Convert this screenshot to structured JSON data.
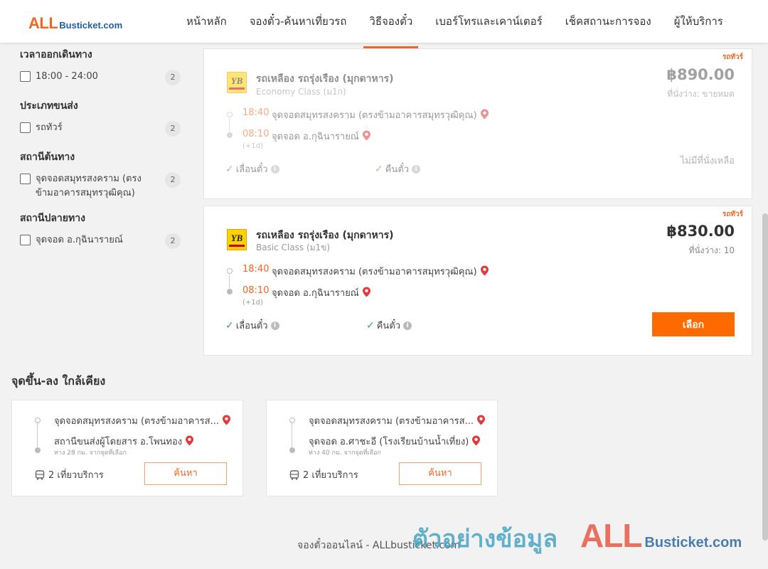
{
  "header": {
    "logo_all": "ALL",
    "logo_bus": "Busticket.com",
    "nav": [
      "หน้าหลัก",
      "จองตั๋ว-ค้นหาเที่ยวรถ",
      "วิธีจองตั๋ว",
      "เบอร์โทรและเคาน์เตอร์",
      "เช็คสถานะการจอง",
      "ผู้ให้บริการ"
    ]
  },
  "filters": {
    "depart_time": {
      "title": "เวลาออกเดินทาง",
      "items": [
        {
          "label": "18:00 - 24:00",
          "count": "2"
        }
      ]
    },
    "vehicle_type": {
      "title": "ประเภทขนส่ง",
      "items": [
        {
          "label": "รถทัวร์",
          "count": "2"
        }
      ]
    },
    "origin": {
      "title": "สถานีต้นทาง",
      "items": [
        {
          "label": "จุดจอดสมุทรสงคราม (ตรงข้ามอาคารสมุทรวุฒิคุณ)",
          "count": "2"
        }
      ]
    },
    "destination": {
      "title": "สถานีปลายทาง",
      "items": [
        {
          "label": "จุดจอด อ.กุฉินารายณ์",
          "count": "2"
        }
      ]
    }
  },
  "results": [
    {
      "type_tag": "รถทัวร์",
      "logo_text": "YB",
      "operator": "รถเหลือง รถรุ่งเรือง (มุกดาหาร)",
      "bus_class": "Economy Class (ม1ก)",
      "price": "฿890.00",
      "seats": "ที่นั่งว่าง: ขายหมด",
      "depart_time": "18:40",
      "depart_stop": "จุดจอดสมุทรสงคราม (ตรงข้ามอาคารสมุทรวุฒิคุณ)",
      "arrive_time": "08:10",
      "arrive_stop": "จุดจอด อ.กุฉินารายณ์",
      "plus_day": "(+1d)",
      "feature_1": "เลื่อนตั๋ว",
      "feature_2": "คืนตั๋ว",
      "status": "ไม่มีที่นั่งเหลือ"
    },
    {
      "type_tag": "รถทัวร์",
      "logo_text": "YB",
      "operator": "รถเหลือง รถรุ่งเรือง (มุกดาหาร)",
      "bus_class": "Basic Class (ม1ข)",
      "price": "฿830.00",
      "seats": "ที่นั่งว่าง: 10",
      "depart_time": "18:40",
      "depart_stop": "จุดจอดสมุทรสงคราม (ตรงข้ามอาคารสมุทรวุฒิคุณ)",
      "arrive_time": "08:10",
      "arrive_stop": "จุดจอด อ.กุฉินารายณ์",
      "plus_day": "(+1d)",
      "feature_1": "เลื่อนตั๋ว",
      "feature_2": "คืนตั๋ว",
      "select_label": "เลือก"
    }
  ],
  "nearby": {
    "title": "จุดขึ้น-ลง ใกล้เคียง",
    "cards": [
      {
        "from": "จุดจอดสมุทรสงคราม (ตรงข้ามอาคารส...",
        "to": "สถานีขนส่งผู้โดยสาร อ.โพนทอง",
        "distance": "ห่าง 28 กม. จากจุดที่เลือก",
        "trips": "2 เที่ยวบริการ",
        "button": "ค้นหา"
      },
      {
        "from": "จุดจอดสมุทรสงคราม (ตรงข้ามอาคารส...",
        "to": "จุดจอด อ.ศาชะอี (โรงเรียนบ้านน้ำเที่ยง)",
        "distance": "ห่าง 40 กม. จากจุดที่เลือก",
        "trips": "2 เที่ยวบริการ",
        "button": "ค้นหา"
      }
    ]
  },
  "footer": {
    "text": "จองตั๋วออนไลน์ - ALLbusticket.com",
    "watermark_text": "ตัวอย่างข้อมูล",
    "watermark_all": "ALL",
    "watermark_bus": "Busticket.com"
  },
  "colors": {
    "accent": "#f26522",
    "button": "#ff6a00",
    "check": "#3aa757",
    "pin": "#e03a3a"
  }
}
